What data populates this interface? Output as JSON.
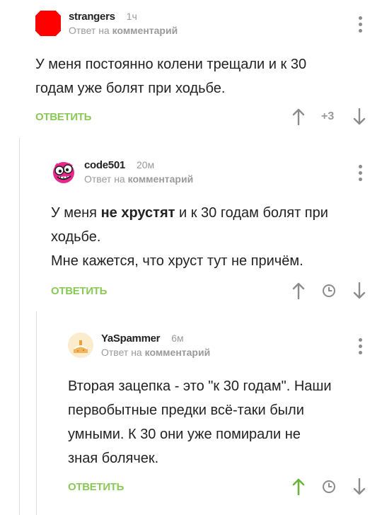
{
  "comments": [
    {
      "author": "strangers",
      "time": "1ч",
      "reply_prefix": "Ответ на",
      "reply_target": "комментарий",
      "text_lines": [
        "У меня постоянно колени трещали и к 30",
        "годам уже болят при ходьбе."
      ],
      "reply_label": "ОТВЕТИТЬ",
      "rating": "+3",
      "avatar_icon": "red-square-avatar"
    },
    {
      "author": "code501",
      "time": "20м",
      "reply_prefix": "Ответ на",
      "reply_target": "комментарий",
      "text_line1_a": "У меня ",
      "text_line1_bold": "не хрустят",
      "text_line1_b": " и к 30 годам болят при",
      "text_line2": "ходьбе.",
      "text_line3": "Мне кажется, что хруст тут не причём.",
      "reply_label": "ОТВЕТИТЬ",
      "avatar_icon": "pink-monster-avatar"
    },
    {
      "author": "YaSpammer",
      "time": "6м",
      "reply_prefix": "Ответ на",
      "reply_target": "комментарий",
      "text_lines": [
        "Вторая зацепка - это \"к 30 годам\". Наши",
        "первобытные предки всё-таки были",
        "умными. К 30 они уже помирали не",
        "зная болячек."
      ],
      "reply_label": "ОТВЕТИТЬ",
      "avatar_icon": "cake-avatar"
    }
  ],
  "colors": {
    "accent_green": "#8ac858",
    "muted_gray": "#9a9a9a",
    "upvoted_green": "#6cb33e"
  }
}
